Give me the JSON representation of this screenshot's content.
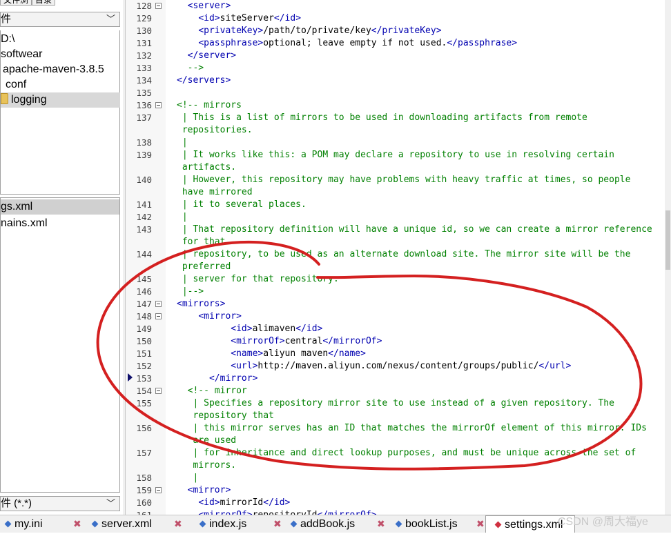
{
  "left_pane": {
    "top_tabs": [
      "文件浏",
      "目录"
    ],
    "folder_combo": "件",
    "tree": [
      {
        "label": "D:\\",
        "indent": 0
      },
      {
        "label": "softwear",
        "indent": 0
      },
      {
        "label": "apache-maven-3.8.5",
        "indent": 1
      },
      {
        "label": "conf",
        "indent": 2
      },
      {
        "label": "logging",
        "indent": 3,
        "selected": true
      }
    ],
    "files": [
      {
        "label": "gs.xml",
        "selected": true
      },
      {
        "label": "nains.xml",
        "selected": false
      }
    ],
    "filter_combo": "件 (*.*)"
  },
  "editor": {
    "lines": [
      {
        "n": "128",
        "fold": true,
        "html": "  <span class=\"tag\">&lt;server&gt;</span>"
      },
      {
        "n": "129",
        "html": "    <span class=\"tag\">&lt;id&gt;</span>siteServer<span class=\"tag\">&lt;/id&gt;</span>"
      },
      {
        "n": "130",
        "html": "    <span class=\"tag\">&lt;privateKey&gt;</span>/path/to/private/key<span class=\"tag\">&lt;/privateKey&gt;</span>"
      },
      {
        "n": "131",
        "html": "    <span class=\"tag\">&lt;passphrase&gt;</span>optional; leave empty if not used.<span class=\"tag\">&lt;/passphrase&gt;</span>"
      },
      {
        "n": "132",
        "html": "  <span class=\"tag\">&lt;/server&gt;</span>"
      },
      {
        "n": "133",
        "html": "  <span class=\"c\">--&gt;</span>"
      },
      {
        "n": "134",
        "html": "<span class=\"tag\">&lt;/servers&gt;</span>"
      },
      {
        "n": "135",
        "html": ""
      },
      {
        "n": "136",
        "fold": true,
        "html": "<span class=\"c\">&lt;!-- mirrors</span>"
      },
      {
        "n": "137",
        "html": "<span class=\"c\"> | This is a list of mirrors to be used in downloading artifacts from remote</span>"
      },
      {
        "n": "",
        "html": "<span class=\"c\"> repositories.</span>"
      },
      {
        "n": "138",
        "html": "<span class=\"c\"> |</span>"
      },
      {
        "n": "139",
        "html": "<span class=\"c\"> | It works like this: a POM may declare a repository to use in resolving certain</span>"
      },
      {
        "n": "",
        "html": "<span class=\"c\"> artifacts.</span>"
      },
      {
        "n": "140",
        "html": "<span class=\"c\"> | However, this repository may have problems with heavy traffic at times, so people</span>"
      },
      {
        "n": "",
        "html": "<span class=\"c\"> have mirrored</span>"
      },
      {
        "n": "141",
        "html": "<span class=\"c\"> | it to several places.</span>"
      },
      {
        "n": "142",
        "html": "<span class=\"c\"> |</span>"
      },
      {
        "n": "143",
        "html": "<span class=\"c\"> | That repository definition will have a unique id, so we can create a mirror reference</span>"
      },
      {
        "n": "",
        "html": "<span class=\"c\"> for that</span>"
      },
      {
        "n": "144",
        "html": "<span class=\"c\"> | repository, to be used as an alternate download site. The mirror site will be the</span>"
      },
      {
        "n": "",
        "html": "<span class=\"c\"> preferred</span>"
      },
      {
        "n": "145",
        "html": "<span class=\"c\"> | server for that repository.</span>"
      },
      {
        "n": "146",
        "html": "<span class=\"c\"> |--&gt;</span>"
      },
      {
        "n": "147",
        "fold": true,
        "html": "<span class=\"tag\">&lt;mirrors&gt;</span>"
      },
      {
        "n": "148",
        "fold": true,
        "html": "    <span class=\"tag\">&lt;mirror&gt;</span>"
      },
      {
        "n": "149",
        "html": "          <span class=\"tag\">&lt;id&gt;</span>alimaven<span class=\"tag\">&lt;/id&gt;</span>"
      },
      {
        "n": "150",
        "html": "          <span class=\"tag\">&lt;mirrorOf&gt;</span>central<span class=\"tag\">&lt;/mirrorOf&gt;</span>"
      },
      {
        "n": "151",
        "html": "          <span class=\"tag\">&lt;name&gt;</span>aliyun maven<span class=\"tag\">&lt;/name&gt;</span>"
      },
      {
        "n": "152",
        "html": "          <span class=\"tag\">&lt;url&gt;</span>http://maven.aliyun.com/nexus/content/groups/public/<span class=\"tag\">&lt;/url&gt;</span>"
      },
      {
        "n": "153",
        "html": "      <span class=\"tag\">&lt;/mirror&gt;</span>"
      },
      {
        "n": "154",
        "fold": true,
        "html": "  <span class=\"c\">&lt;!-- mirror</span>"
      },
      {
        "n": "155",
        "html": "<span class=\"c\">   | Specifies a repository mirror site to use instead of a given repository. The</span>"
      },
      {
        "n": "",
        "html": "<span class=\"c\">   repository that</span>"
      },
      {
        "n": "156",
        "html": "<span class=\"c\">   | this mirror serves has an ID that matches the mirrorOf element of this mirror. IDs</span>"
      },
      {
        "n": "",
        "html": "<span class=\"c\">   are used</span>"
      },
      {
        "n": "157",
        "html": "<span class=\"c\">   | for inheritance and direct lookup purposes, and must be unique across the set of</span>"
      },
      {
        "n": "",
        "html": "<span class=\"c\">   mirrors.</span>"
      },
      {
        "n": "158",
        "html": "<span class=\"c\">   |</span>"
      },
      {
        "n": "159",
        "fold": true,
        "html": "  <span class=\"tag\">&lt;mirror&gt;</span>"
      },
      {
        "n": "160",
        "html": "    <span class=\"tag\">&lt;id&gt;</span>mirrorId<span class=\"tag\">&lt;/id&gt;</span>"
      },
      {
        "n": "161",
        "html": "    <span class=\"tag\">&lt;mirrorOf&gt;</span>repositoryId<span class=\"tag\">&lt;/mirrorOf&gt;</span>"
      }
    ]
  },
  "tabs": [
    {
      "label": "my.ini",
      "icon_color": "#3a6fc8"
    },
    {
      "label": "server.xml",
      "icon_color": "#3a6fc8"
    },
    {
      "label": "index.js",
      "icon_color": "#3a6fc8"
    },
    {
      "label": "addBook.js",
      "icon_color": "#3a6fc8"
    },
    {
      "label": "bookList.js",
      "icon_color": "#3a6fc8"
    },
    {
      "label": "settings.xml",
      "icon_color": "#d03040",
      "active": true
    }
  ],
  "close_glyph": "✖",
  "watermark": "CSDN @周大福ye",
  "colors": {
    "tag": "#0000b0",
    "comment": "#008000",
    "annotation": "#d42020"
  }
}
